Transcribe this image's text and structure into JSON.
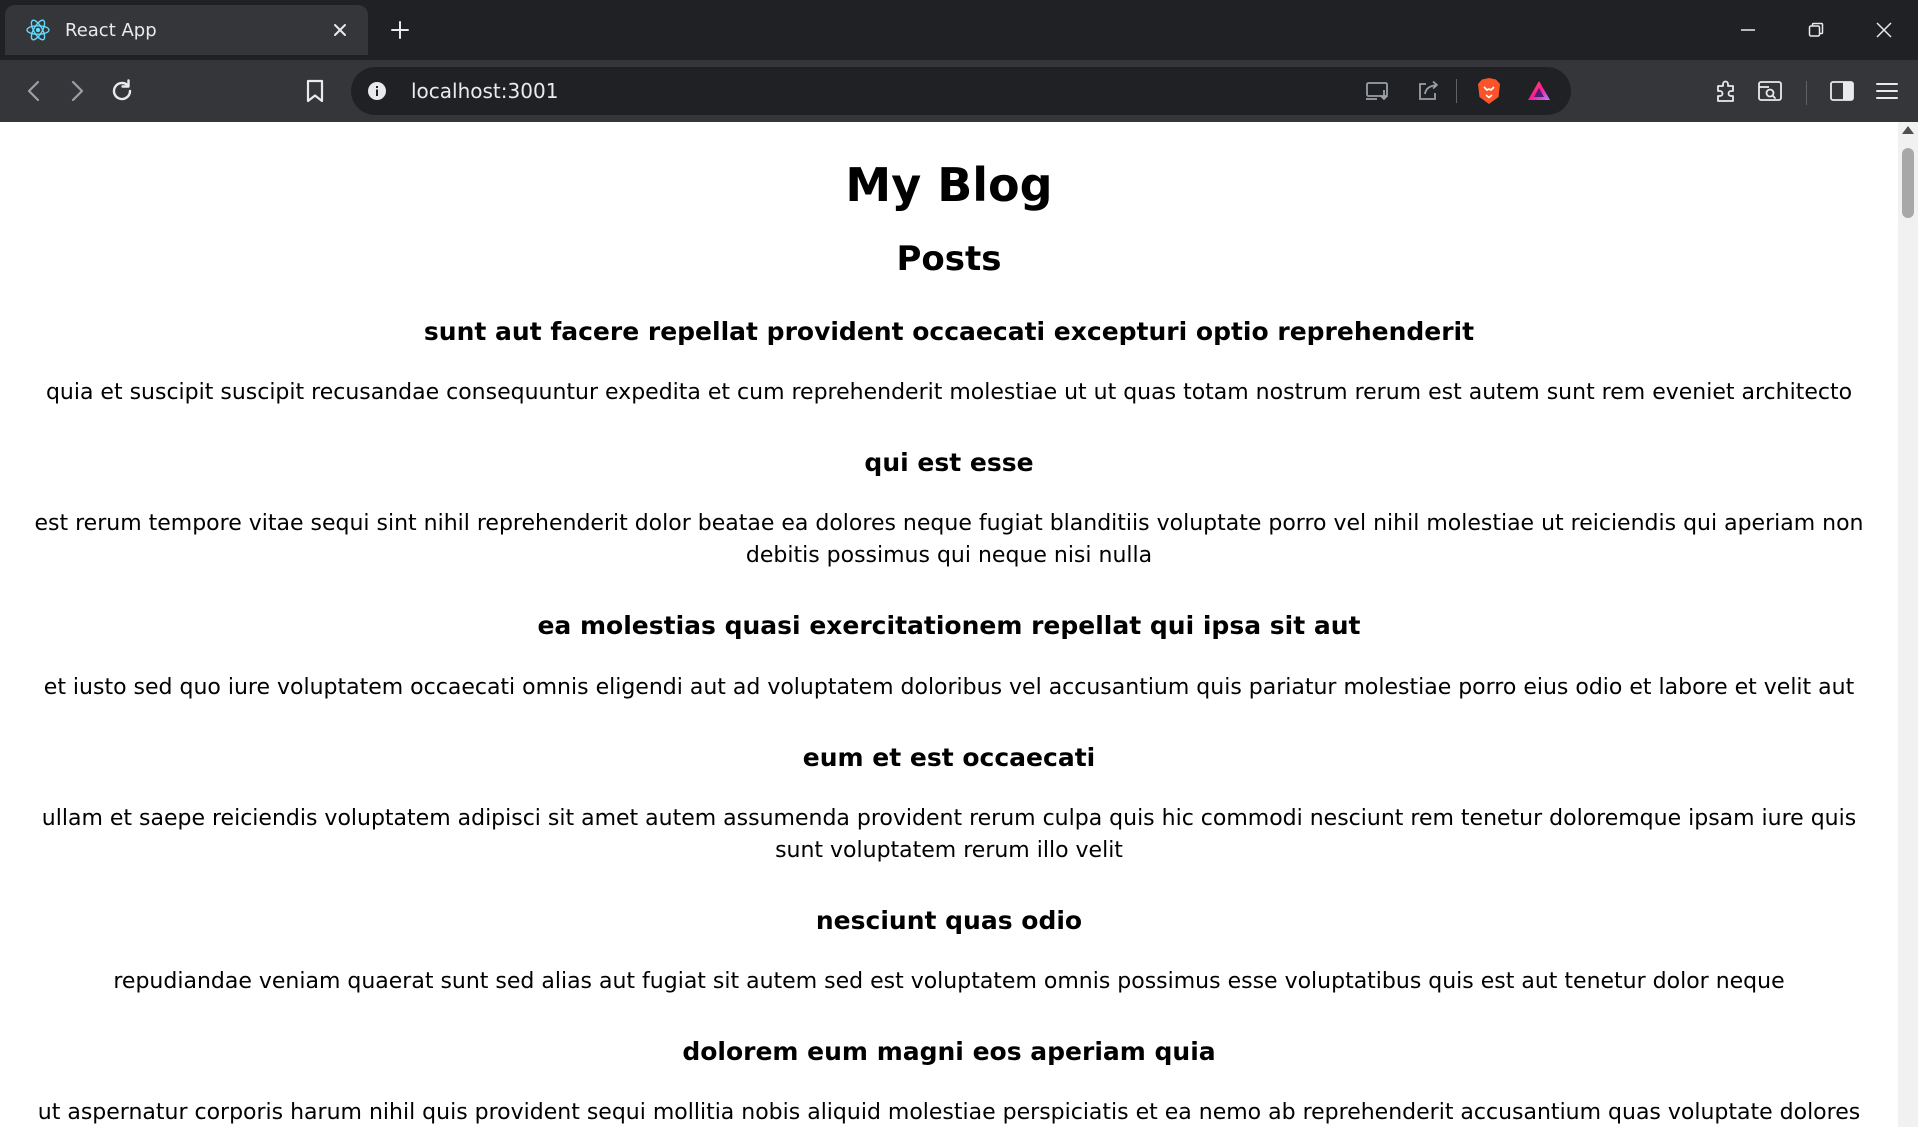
{
  "browser": {
    "tab": {
      "title": "React App",
      "favicon": "react-icon"
    },
    "address_bar": {
      "url": "localhost:3001"
    },
    "colors": {
      "frame": "#202124",
      "toolbar": "#35363a",
      "brave_orange": "#fb542b"
    }
  },
  "page": {
    "title": "My Blog",
    "posts_heading": "Posts",
    "posts": [
      {
        "title": "sunt aut facere repellat provident occaecati excepturi optio reprehenderit",
        "body": "quia et suscipit suscipit recusandae consequuntur expedita et cum reprehenderit molestiae ut ut quas totam nostrum rerum est autem sunt rem eveniet architecto"
      },
      {
        "title": "qui est esse",
        "body": "est rerum tempore vitae sequi sint nihil reprehenderit dolor beatae ea dolores neque fugiat blanditiis voluptate porro vel nihil molestiae ut reiciendis qui aperiam non debitis possimus qui neque nisi nulla"
      },
      {
        "title": "ea molestias quasi exercitationem repellat qui ipsa sit aut",
        "body": "et iusto sed quo iure voluptatem occaecati omnis eligendi aut ad voluptatem doloribus vel accusantium quis pariatur molestiae porro eius odio et labore et velit aut"
      },
      {
        "title": "eum et est occaecati",
        "body": "ullam et saepe reiciendis voluptatem adipisci sit amet autem assumenda provident rerum culpa quis hic commodi nesciunt rem tenetur doloremque ipsam iure quis sunt voluptatem rerum illo velit"
      },
      {
        "title": "nesciunt quas odio",
        "body": "repudiandae veniam quaerat sunt sed alias aut fugiat sit autem sed est voluptatem omnis possimus esse voluptatibus quis est aut tenetur dolor neque"
      },
      {
        "title": "dolorem eum magni eos aperiam quia",
        "body": "ut aspernatur corporis harum nihil quis provident sequi mollitia nobis aliquid molestiae perspiciatis et ea nemo ab reprehenderit accusantium quas voluptate dolores velit et doloremque molestiae"
      }
    ]
  }
}
